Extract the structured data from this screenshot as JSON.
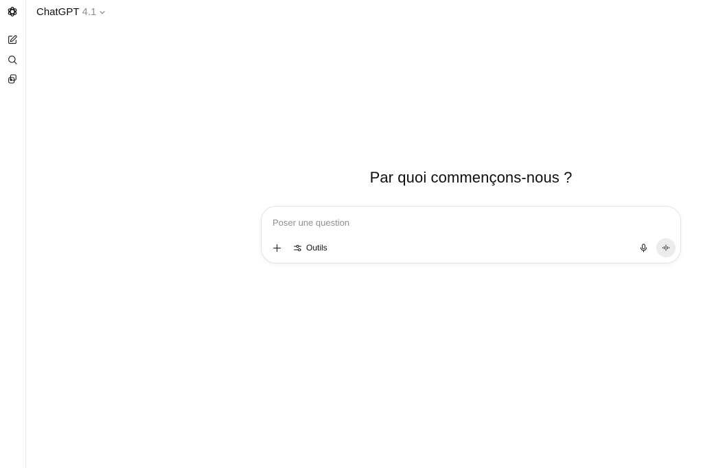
{
  "header": {
    "model_name": "ChatGPT",
    "model_version": "4.1"
  },
  "sidebar": {
    "icons": [
      "openai-logo-icon",
      "new-chat-icon",
      "search-icon",
      "library-icon"
    ]
  },
  "main": {
    "headline": "Par quoi commençons-nous ?"
  },
  "composer": {
    "placeholder": "Poser une question",
    "value": "",
    "tools_label": "Outils",
    "icons": [
      "plus-icon",
      "tools-sliders-icon",
      "microphone-icon",
      "voice-waveform-icon"
    ]
  },
  "colors": {
    "text": "#0d0d0d",
    "muted": "#8f8f8f",
    "border": "#e3e3e3",
    "voice_button_bg": "#ececec"
  }
}
